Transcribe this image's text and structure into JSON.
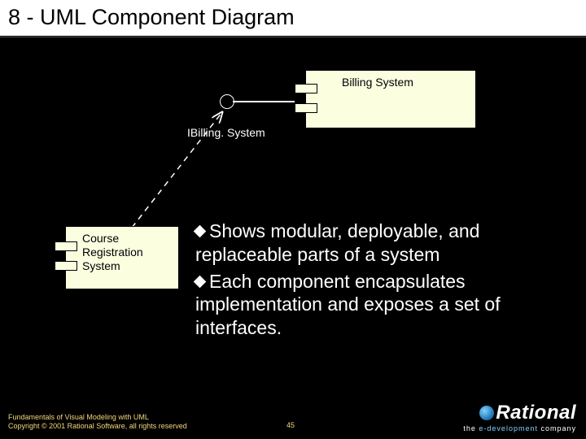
{
  "title": "8 - UML Component Diagram",
  "components": {
    "billing": {
      "name": "Billing System"
    },
    "crs": {
      "name": "Course Registration System"
    }
  },
  "interface": {
    "label": "IBilling. System"
  },
  "bullets": [
    "Shows modular, deployable, and replaceable parts of a system",
    "Each component encapsulates implementation and exposes a set of interfaces."
  ],
  "footer": {
    "line1": "Fundamentals of Visual Modeling with UML",
    "line2": "Copyright © 2001 Rational Software, all rights reserved"
  },
  "page_number": "45",
  "logo": {
    "brand": "Rational",
    "tag_pre": "the ",
    "tag_em": "e-development",
    "tag_post": " company"
  }
}
